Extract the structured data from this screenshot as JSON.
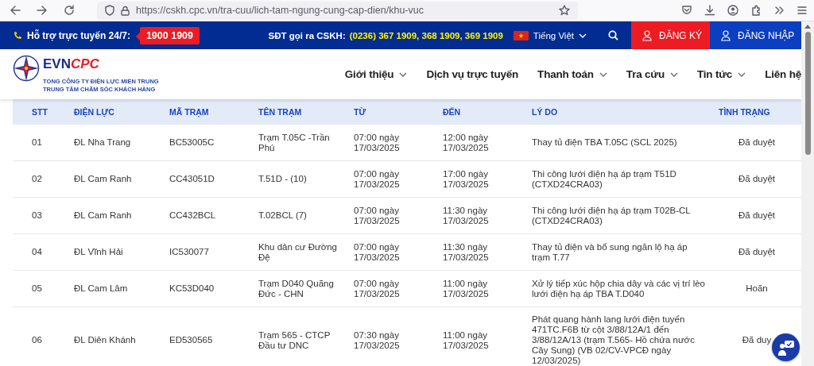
{
  "browser": {
    "url": "https://cskh.cpc.vn/tra-cuu/lich-tam-ngung-cung-cap-dien/khu-vuc"
  },
  "topbar": {
    "support_label": "Hỗ trợ trực tuyến 24/7:",
    "hotline": "1900 1909",
    "cskh_label": "SĐT gọi ra CSKH:",
    "cskh_numbers": "(0236) 367 1909, 368 1909, 369 1909",
    "language": "Tiếng Việt",
    "register": "ĐĂNG KÝ",
    "login": "ĐĂNG NHẬP"
  },
  "logo": {
    "brand_main": "EVN",
    "brand_accent": "CPC",
    "line_1": "TỔNG CÔNG TY ĐIỆN LỰC MIỀN TRUNG",
    "line_2": "TRUNG TÂM CHĂM SÓC KHÁCH HÀNG"
  },
  "nav": [
    {
      "label": "Giới thiệu",
      "has_menu": true
    },
    {
      "label": "Dịch vụ trực tuyến",
      "has_menu": false
    },
    {
      "label": "Thanh toán",
      "has_menu": true
    },
    {
      "label": "Tra cứu",
      "has_menu": true
    },
    {
      "label": "Tin tức",
      "has_menu": true
    },
    {
      "label": "Liên hệ",
      "has_menu": false
    }
  ],
  "table": {
    "columns": [
      "STT",
      "ĐIỆN LỰC",
      "MÃ TRẠM",
      "TÊN TRẠM",
      "TỪ",
      "ĐẾN",
      "LÝ DO",
      "TÌNH TRẠNG"
    ],
    "rows": [
      {
        "cells": [
          "01",
          "ĐL Nha Trang",
          "BC53005C",
          "Trạm T.05C -Trần Phú",
          "07:00 ngày 17/03/2025",
          "12:00 ngày 17/03/2025",
          "Thay tủ điện TBA T.05C (SCL 2025)",
          "Đã duyệt"
        ]
      },
      {
        "cells": [
          "02",
          "ĐL Cam Ranh",
          "CC43051D",
          "T.51D - (10)",
          "07:00 ngày 17/03/2025",
          "17:00 ngày 17/03/2025",
          "Thi công lưới điện hạ áp trạm T51D (CTXD24CRA03)",
          "Đã duyệt"
        ]
      },
      {
        "cells": [
          "03",
          "ĐL Cam Ranh",
          "CC432BCL",
          "T.02BCL (7)",
          "07:00 ngày 17/03/2025",
          "11:30 ngày 17/03/2025",
          "Thi công lưới điện hạ áp trạm T02B-CL (CTXD24CRA03)",
          "Đã duyệt"
        ]
      },
      {
        "cells": [
          "04",
          "ĐL Vĩnh Hải",
          "IC530077",
          "Khu dân cư Đường Đệ",
          "07:00 ngày 17/03/2025",
          "11:30 ngày 17/03/2025",
          "Thay tủ điện và bổ sung ngăn lộ hạ áp trạm T.77",
          "Đã duyệt"
        ]
      },
      {
        "cells": [
          "05",
          "ĐL Cam Lâm",
          "KC53D040",
          "Trạm D040 Quãng Đức - CHN",
          "07:00 ngày 17/03/2025",
          "11:00 ngày 17/03/2025",
          "Xử lý tiếp xúc hộp chia dây và các vị trí lèo lưới điện hạ áp TBA T.D040",
          "Hoãn"
        ]
      },
      {
        "cells": [
          "06",
          "ĐL Diên Khánh",
          "ED530565",
          "Trạm 565 - CTCP Đầu tư DNC",
          "07:30 ngày 17/03/2025",
          "11:00 ngày 17/03/2025",
          "Phát quang hành lang lưới điện tuyến 471TC.F6B từ cột 3/88/12A/1 đến 3/88/12A/13 (trạm T.565- Hồ chứa nước Cây Sung) (VB 02/CV-VPCĐ ngày 12/03/2025)",
          "Đã duy"
        ]
      }
    ]
  }
}
